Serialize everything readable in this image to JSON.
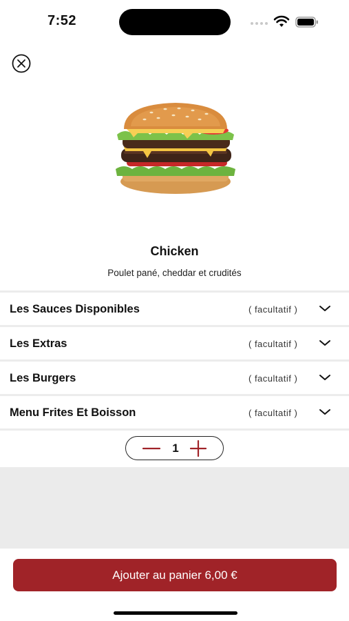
{
  "status_bar": {
    "time": "7:52"
  },
  "product": {
    "title": "Chicken",
    "description": "Poulet pané, cheddar et crudités",
    "image_name": "burger-image"
  },
  "options": [
    {
      "label": "Les Sauces Disponibles",
      "tag": "( facultatif )"
    },
    {
      "label": "Les Extras",
      "tag": "( facultatif )"
    },
    {
      "label": "Les Burgers",
      "tag": "( facultatif )"
    },
    {
      "label": "Menu Frites Et Boisson",
      "tag": "( facultatif )"
    }
  ],
  "quantity": {
    "value": "1"
  },
  "cart": {
    "label": "Ajouter au panier 6,00 €"
  },
  "colors": {
    "accent": "#a02328",
    "divider": "#ececec",
    "gray_area": "#ebebeb"
  },
  "icons": {
    "close": "close-circle-icon",
    "chevron": "chevron-down-icon",
    "minus": "minus-icon",
    "plus": "plus-icon"
  }
}
